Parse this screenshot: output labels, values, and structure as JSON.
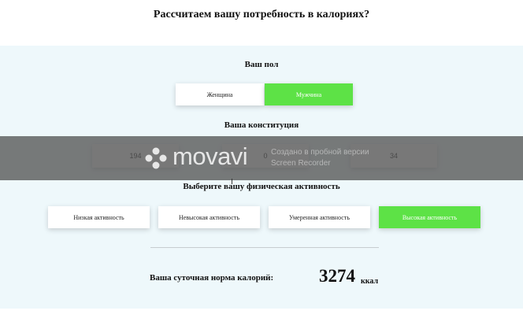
{
  "page_title": "Рассчитаем вашу потребность в калориях?",
  "gender": {
    "label": "Ваш пол",
    "options": [
      "Женщина",
      "Мужчина"
    ],
    "selected": "Мужчина"
  },
  "constitution": {
    "label": "Ваша конституция",
    "fields": [
      "194",
      "0",
      "34"
    ]
  },
  "activity": {
    "label": "Выберите вашу физическая активность",
    "options": [
      "Низкая активность",
      "Невысокая активность",
      "Умеренная активность",
      "Высокая активность"
    ],
    "selected": "Высокая активность"
  },
  "result": {
    "label": "Ваша суточная норма калорий:",
    "value": "3274",
    "unit": "ккал"
  },
  "watermark": {
    "brand": "movavi",
    "line1": "Создано в пробной версии",
    "line2": "Screen Recorder"
  },
  "colors": {
    "accent": "#5de246",
    "panel_bg": "#eef8fb"
  }
}
